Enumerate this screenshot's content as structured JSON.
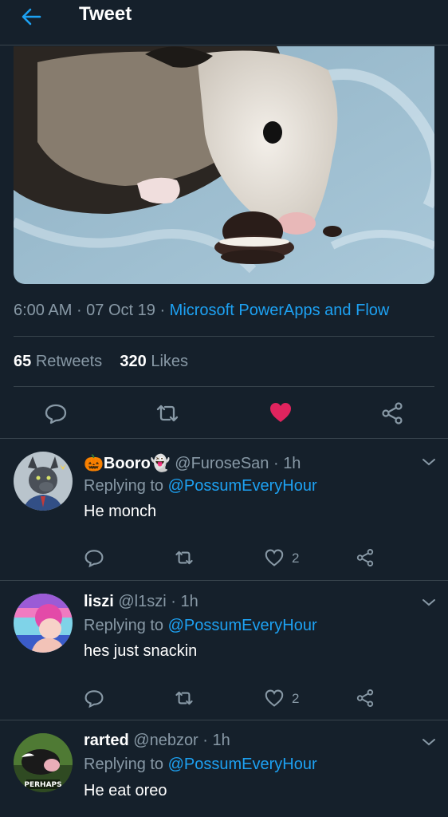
{
  "header": {
    "title": "Tweet"
  },
  "tweet": {
    "time": "6:00 AM",
    "date": "07 Oct 19",
    "source": "Microsoft PowerApps and Flow",
    "retweets_count": "65",
    "retweets_label": "Retweets",
    "likes_count": "320",
    "likes_label": "Likes"
  },
  "replies": [
    {
      "name": "Booro",
      "handle": "@FuroseSan",
      "time": "1h",
      "replying_label": "Replying to",
      "replying_to": "@PossumEveryHour",
      "text": "He monch",
      "likes": "2"
    },
    {
      "name": "liszi",
      "handle": "@l1szi",
      "time": "1h",
      "replying_label": "Replying to",
      "replying_to": "@PossumEveryHour",
      "text": "hes just snackin",
      "likes": "2"
    },
    {
      "name": "rarted",
      "handle": "@nebzor",
      "time": "1h",
      "replying_label": "Replying to",
      "replying_to": "@PossumEveryHour",
      "text": "He eat oreo",
      "avatar_caption": "PERHAPS"
    }
  ],
  "colors": {
    "background": "#15202b",
    "accent": "#1da1f2",
    "like": "#e0245e",
    "muted": "#8899a6",
    "divider": "#38444d"
  },
  "icons": [
    "back-arrow-icon",
    "comment-icon",
    "retweet-icon",
    "heart-icon",
    "share-icon",
    "chevron-down-icon"
  ]
}
